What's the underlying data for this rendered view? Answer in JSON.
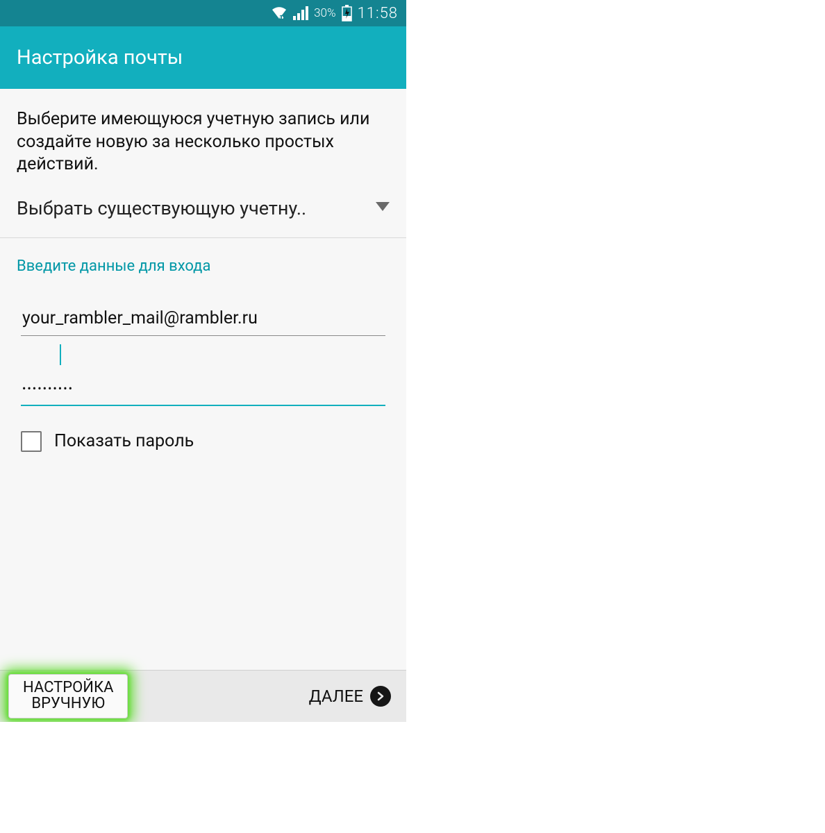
{
  "status": {
    "battery_percent": "30%",
    "time": "11:58"
  },
  "header": {
    "title": "Настройка почты"
  },
  "body": {
    "instructions": "Выберите имеющуюся учетную запись или создайте новую за несколько простых действий.",
    "account_selector": "Выбрать существующую учетну..",
    "login_section_label": "Введите данные для входа",
    "email_value": "your_rambler_mail@rambler.ru",
    "password_value": "••••••••••",
    "show_password_label": "Показать пароль"
  },
  "footer": {
    "manual_button_line1": "НАСТРОЙКА",
    "manual_button_line2": "ВРУЧНУЮ",
    "next_button": "ДАЛЕЕ"
  }
}
